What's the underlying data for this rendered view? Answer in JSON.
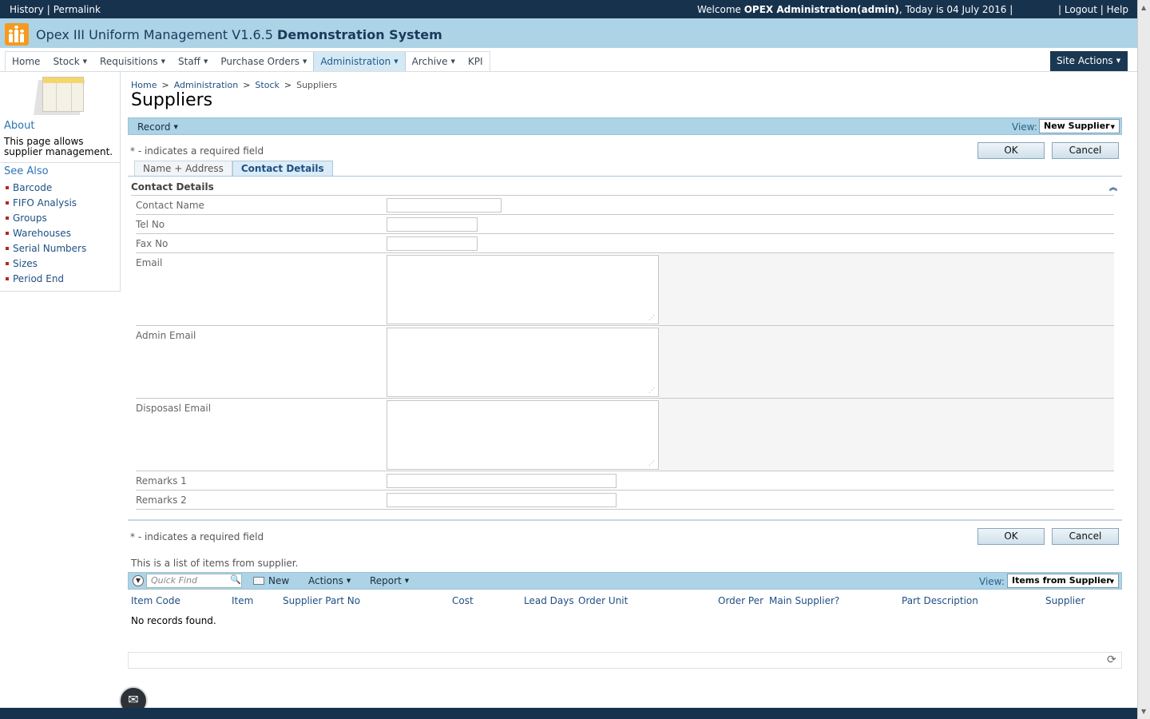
{
  "topbar": {
    "history": "History",
    "permalink": "Permalink",
    "welcome_prefix": "Welcome ",
    "welcome_user": "OPEX Administration(admin)",
    "welcome_suffix": ", Today is 04 July 2016 |",
    "logout": "| Logout",
    "help": "| Help"
  },
  "app": {
    "title_normal": "Opex III Uniform Management V1.6.5 ",
    "title_bold": "Demonstration System",
    "logo_icon": "people-group-icon",
    "brand_color": "#f59a1e"
  },
  "nav": {
    "items": [
      {
        "label": "Home",
        "dropdown": false
      },
      {
        "label": "Stock",
        "dropdown": true
      },
      {
        "label": "Requisitions",
        "dropdown": true
      },
      {
        "label": "Staff",
        "dropdown": true
      },
      {
        "label": "Purchase Orders",
        "dropdown": true
      },
      {
        "label": "Administration",
        "dropdown": true,
        "active": true
      },
      {
        "label": "Archive",
        "dropdown": true
      },
      {
        "label": "KPI",
        "dropdown": false
      }
    ],
    "site_actions": "Site Actions"
  },
  "sidebar": {
    "about_heading": "About",
    "about_text": "This page allows supplier management.",
    "seealso_heading": "See Also",
    "links": [
      "Barcode",
      "FIFO Analysis",
      "Groups",
      "Warehouses",
      "Serial Numbers",
      "Sizes",
      "Period End"
    ]
  },
  "breadcrumb": {
    "items": [
      "Home",
      "Administration",
      "Stock",
      "Suppliers"
    ],
    "separator": ">"
  },
  "page_title": "Suppliers",
  "form_toolbar": {
    "record": "Record",
    "view_label": "View:",
    "view_value": "New Supplier"
  },
  "required_note": "* - indicates a required field",
  "buttons": {
    "ok": "OK",
    "cancel": "Cancel"
  },
  "tabs": [
    {
      "label": "Name + Address",
      "active": false
    },
    {
      "label": "Contact Details",
      "active": true
    }
  ],
  "section": {
    "title": "Contact Details",
    "collapse_icon": "double-chevron-up-icon"
  },
  "fields": {
    "contact_name": {
      "label": "Contact Name",
      "value": ""
    },
    "tel_no": {
      "label": "Tel No",
      "value": ""
    },
    "fax_no": {
      "label": "Fax No",
      "value": ""
    },
    "email": {
      "label": "Email",
      "value": ""
    },
    "admin_email": {
      "label": "Admin Email",
      "value": ""
    },
    "disposal_email": {
      "label": "Disposasl Email",
      "value": ""
    },
    "remarks1": {
      "label": "Remarks 1",
      "value": ""
    },
    "remarks2": {
      "label": "Remarks 2",
      "value": ""
    }
  },
  "items_list": {
    "note": "This is a list of items from supplier.",
    "quick_find_placeholder": "Quick Find",
    "new": "New",
    "actions": "Actions",
    "report": "Report",
    "view_label": "View:",
    "view_value": "Items from Supplier",
    "columns": [
      "Item Code",
      "Item",
      "Supplier Part No",
      "Cost",
      "Lead Days",
      "Order Unit",
      "Order Per",
      "Main Supplier?",
      "Part Description",
      "Supplier"
    ],
    "empty_message": "No records found."
  },
  "icons": {
    "refresh": "refresh-icon",
    "mail": "mail-icon",
    "search": "search-icon"
  },
  "colors": {
    "header_bar": "#17324d",
    "title_band": "#acd3e6",
    "toolbar": "#acd3e6",
    "link": "#1f4f84",
    "bullet": "#b5281c"
  }
}
